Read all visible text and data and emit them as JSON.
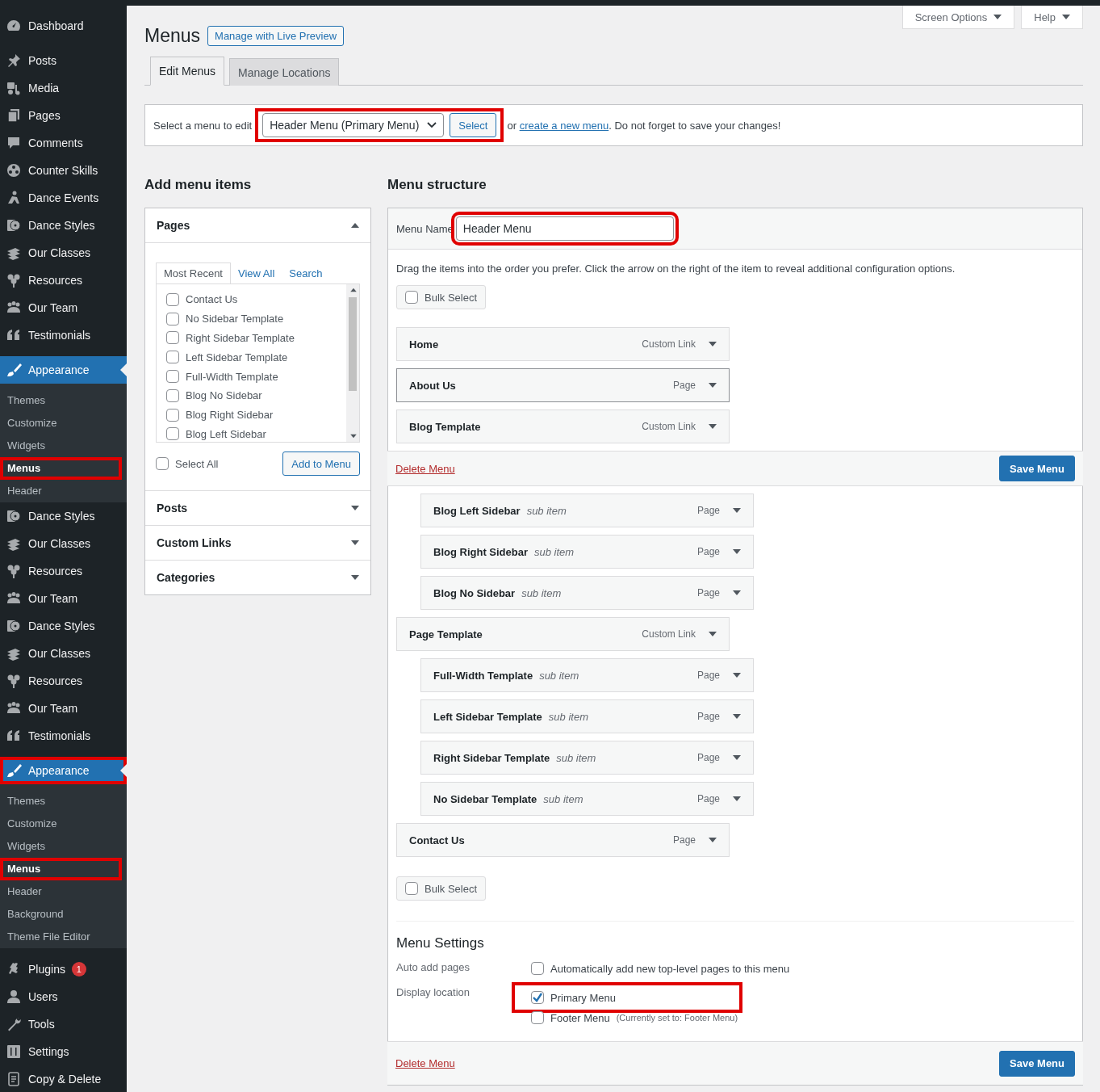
{
  "sidebar": {
    "groups": [
      [
        {
          "label": "Dashboard",
          "current": false
        }
      ],
      [
        {
          "label": "Posts",
          "current": false
        },
        {
          "label": "Media",
          "current": false
        },
        {
          "label": "Pages",
          "current": false
        },
        {
          "label": "Comments",
          "current": false
        },
        {
          "label": "Counter Skills",
          "current": false
        },
        {
          "label": "Dance Events",
          "current": false
        },
        {
          "label": "Dance Styles",
          "current": false
        },
        {
          "label": "Our Classes",
          "current": false
        },
        {
          "label": "Resources",
          "current": false
        },
        {
          "label": "Our Team",
          "current": false
        },
        {
          "label": "Testimonials",
          "current": false
        }
      ],
      [
        {
          "label": "Appearance",
          "current": true,
          "highlighted": false,
          "submenu": [
            {
              "label": "Themes",
              "current": false,
              "highlighted": false
            },
            {
              "label": "Customize",
              "current": false,
              "highlighted": false
            },
            {
              "label": "Widgets",
              "current": false,
              "highlighted": false
            },
            {
              "label": "Menus",
              "current": true,
              "highlighted": true
            },
            {
              "label": "Header",
              "current": false,
              "highlighted": false
            }
          ]
        },
        {
          "label": "Dance Styles",
          "current": false
        },
        {
          "label": "Our Classes",
          "current": false
        },
        {
          "label": "Resources",
          "current": false
        },
        {
          "label": "Our Team",
          "current": false
        },
        {
          "label": "Dance Styles",
          "current": false
        },
        {
          "label": "Our Classes",
          "current": false
        },
        {
          "label": "Resources",
          "current": false
        },
        {
          "label": "Our Team",
          "current": false
        },
        {
          "label": "Testimonials",
          "current": false
        }
      ],
      [
        {
          "label": "Appearance",
          "current": true,
          "highlighted": true,
          "submenu": [
            {
              "label": "Themes",
              "current": false,
              "highlighted": false
            },
            {
              "label": "Customize",
              "current": false,
              "highlighted": false
            },
            {
              "label": "Widgets",
              "current": false,
              "highlighted": false
            },
            {
              "label": "Menus",
              "current": true,
              "highlighted": true
            },
            {
              "label": "Header",
              "current": false,
              "highlighted": false
            },
            {
              "label": "Background",
              "current": false,
              "highlighted": false
            },
            {
              "label": "Theme File Editor",
              "current": false,
              "highlighted": false
            }
          ]
        }
      ],
      [
        {
          "label": "Plugins",
          "current": false,
          "badge": "1"
        },
        {
          "label": "Users",
          "current": false
        },
        {
          "label": "Tools",
          "current": false
        },
        {
          "label": "Settings",
          "current": false
        },
        {
          "label": "Copy & Delete",
          "current": false
        }
      ]
    ]
  },
  "top_buttons": [
    "Screen Options",
    "Help"
  ],
  "page": {
    "title": "Menus",
    "title_action": "Manage with Live Preview"
  },
  "tabs": [
    {
      "label": "Edit Menus",
      "selected": true
    },
    {
      "label": "Manage Locations",
      "selected": false
    }
  ],
  "select_bar": {
    "label": "Select a menu to edit",
    "value": "Header Menu (Primary Menu)",
    "button": "Select",
    "highlighted": true,
    "text_before_link": "or",
    "link": "create a new menu",
    "text_after_link": ". Do not forget to save your changes!"
  },
  "add_items": {
    "title": "Add menu items",
    "panels": [
      {
        "title": "Pages",
        "expanded": true,
        "tabs": [
          {
            "label": "Most Recent",
            "selected": true
          },
          {
            "label": "View All",
            "selected": false
          },
          {
            "label": "Search",
            "selected": false
          }
        ],
        "items": [
          {
            "label": "Contact Us",
            "checked": false
          },
          {
            "label": "No Sidebar Template",
            "checked": false
          },
          {
            "label": "Right Sidebar Template",
            "checked": false
          },
          {
            "label": "Left Sidebar Template",
            "checked": false
          },
          {
            "label": "Full-Width Template",
            "checked": false
          },
          {
            "label": "Blog No Sidebar",
            "checked": false
          },
          {
            "label": "Blog Right Sidebar",
            "checked": false
          },
          {
            "label": "Blog Left Sidebar",
            "checked": false
          }
        ],
        "select_all": {
          "label": "Select All",
          "checked": false
        },
        "button": "Add to Menu"
      },
      {
        "title": "Posts",
        "expanded": false
      },
      {
        "title": "Custom Links",
        "expanded": false
      },
      {
        "title": "Categories",
        "expanded": false
      }
    ]
  },
  "menu_structure": {
    "title": "Menu structure",
    "name_label": "Menu Name",
    "name_value": "Header Menu",
    "name_highlighted": true,
    "instructions": "Drag the items into the order you prefer. Click the arrow on the right of the item to reveal additional configuration options.",
    "bulk_select": {
      "label": "Bulk Select",
      "checked": false
    },
    "items": [
      {
        "kind": "item",
        "title": "Home",
        "type": "Custom Link",
        "focused": false
      },
      {
        "kind": "item",
        "title": "About Us",
        "type": "Page",
        "focused": true
      },
      {
        "kind": "item",
        "title": "Blog Template",
        "type": "Custom Link",
        "focused": false
      },
      {
        "kind": "footer",
        "delete": "Delete Menu",
        "save": "Save Menu"
      },
      {
        "kind": "sub",
        "title": "Blog Left Sidebar",
        "note": "sub item",
        "type": "Page",
        "focused": false
      },
      {
        "kind": "sub",
        "title": "Blog Right Sidebar",
        "note": "sub item",
        "type": "Page",
        "focused": false
      },
      {
        "kind": "sub",
        "title": "Blog No Sidebar",
        "note": "sub item",
        "type": "Page",
        "focused": false
      },
      {
        "kind": "item",
        "title": "Page Template",
        "type": "Custom Link",
        "focused": false
      },
      {
        "kind": "sub",
        "title": "Full-Width Template",
        "note": "sub item",
        "type": "Page",
        "focused": false
      },
      {
        "kind": "sub",
        "title": "Left Sidebar Template",
        "note": "sub item",
        "type": "Page",
        "focused": false
      },
      {
        "kind": "sub",
        "title": "Right Sidebar Template",
        "note": "sub item",
        "type": "Page",
        "focused": false
      },
      {
        "kind": "sub",
        "title": "No Sidebar Template",
        "note": "sub item",
        "type": "Page",
        "focused": false
      },
      {
        "kind": "item",
        "title": "Contact Us",
        "type": "Page",
        "focused": false
      }
    ],
    "bulk_select_bottom": {
      "label": "Bulk Select",
      "checked": false
    },
    "settings": {
      "title": "Menu Settings",
      "rows": [
        {
          "label": "Auto add pages",
          "options": [
            {
              "label": "Automatically add new top-level pages to this menu",
              "checked": false,
              "highlighted": false
            }
          ]
        },
        {
          "label": "Display location",
          "options": [
            {
              "label": "Primary Menu",
              "checked": true,
              "highlighted": true
            },
            {
              "label": "Footer Menu",
              "note": "(Currently set to: Footer Menu)",
              "checked": false,
              "highlighted": false
            }
          ]
        }
      ]
    },
    "footer": {
      "delete": "Delete Menu",
      "save": "Save Menu"
    }
  }
}
